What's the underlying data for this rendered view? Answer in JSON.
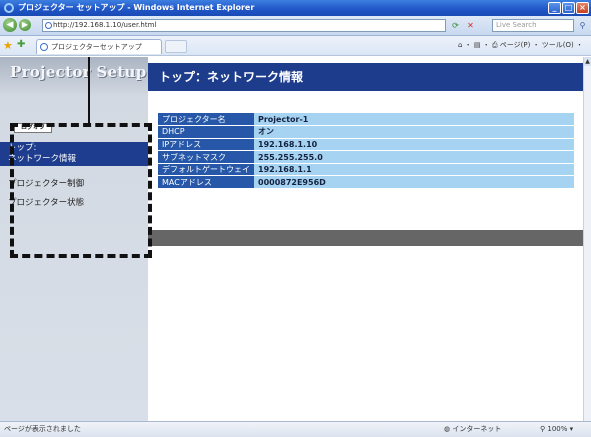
{
  "window": {
    "title": "プロジェクター セットアップ - Windows Internet Explorer"
  },
  "browser": {
    "back_icon": "back-arrow-icon",
    "forward_icon": "forward-arrow-icon",
    "address": "http://192.168.1.10/user.html",
    "search_placeholder": "Live Search",
    "tab_title": "プロジェクターセットアップ",
    "command_bar": "ページ(P) ・ ツール(O) ・"
  },
  "sidebar": {
    "title": "Projector Setup",
    "logout_label": "ログオフ",
    "items": [
      {
        "line1": "トップ:",
        "line2": "ネットワーク情報",
        "active": true
      },
      {
        "label": "プロジェクター制御",
        "active": false
      },
      {
        "label": "プロジェクター状態",
        "active": false
      }
    ]
  },
  "main": {
    "header": "トップ：ネットワーク情報",
    "rows": [
      {
        "key": "プロジェクター名",
        "value": "Projector-1"
      },
      {
        "key": "DHCP",
        "value": "オン"
      },
      {
        "key": "IPアドレス",
        "value": "192.168.1.10"
      },
      {
        "key": "サブネットマスク",
        "value": "255.255.255.0"
      },
      {
        "key": "デフォルトゲートウェイ",
        "value": "192.168.1.1"
      },
      {
        "key": "MACアドレス",
        "value": "0000872E956D"
      }
    ]
  },
  "status": {
    "text": "ページが表示されました",
    "zone": "インターネット",
    "zoom": "100%"
  },
  "colors": {
    "header_bg": "#1d3c8c",
    "key_bg": "#2657a8",
    "value_bg": "#a7d3f3",
    "menu_active_bg": "#1e3d8f"
  }
}
